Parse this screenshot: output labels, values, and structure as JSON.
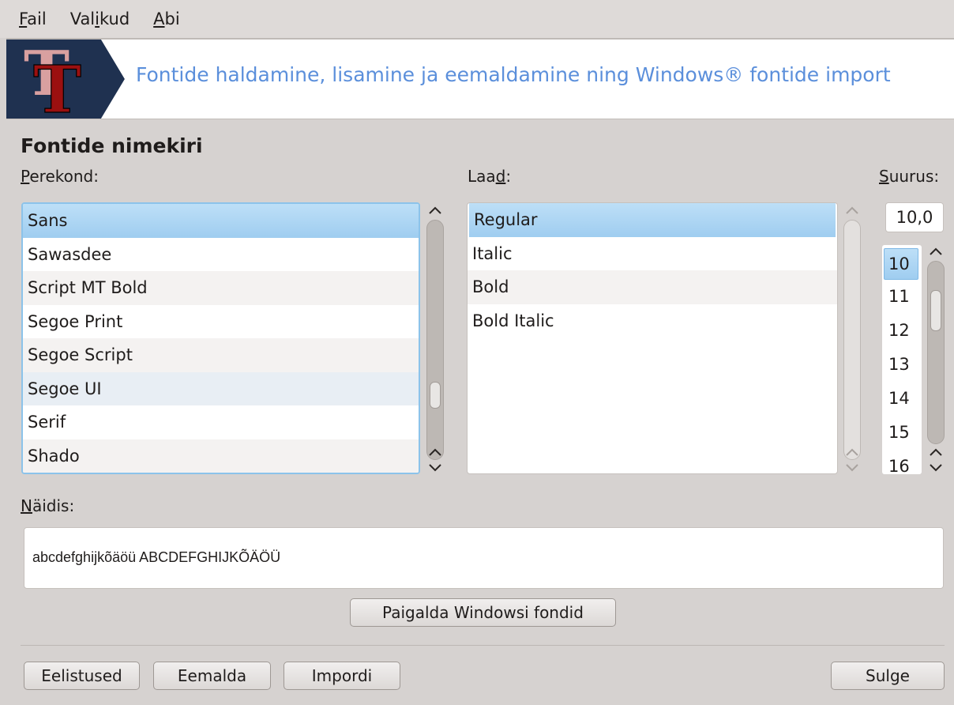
{
  "menu": {
    "items": [
      {
        "first": "F",
        "rest": "ail",
        "pre": ""
      },
      {
        "pre": "Val",
        "first": "i",
        "rest": "kud"
      },
      {
        "first": "A",
        "rest": "bi",
        "pre": ""
      }
    ]
  },
  "banner": {
    "text": "Fontide haldamine, lisamine ja eemaldamine ning Windows® fontide import",
    "logo_letters": "TT"
  },
  "section": {
    "title": "Fontide nimekiri"
  },
  "family": {
    "label_first": "P",
    "label_rest": "erekond:",
    "items": [
      "Sans",
      "Sawasdee",
      "Script MT Bold",
      "Segoe Print",
      "Segoe Script",
      "Segoe UI",
      "Serif",
      "Shado"
    ],
    "selected": "Sans"
  },
  "style": {
    "label_pre": "Laa",
    "label_u": "d",
    "label_post": ":",
    "items": [
      "Regular",
      "Italic",
      "Bold",
      "Bold Italic"
    ],
    "selected": "Regular"
  },
  "size": {
    "label_first": "S",
    "label_rest": "uurus:",
    "value": "10,0",
    "items": [
      "10",
      "11",
      "12",
      "13",
      "14",
      "15",
      "16"
    ],
    "selected": "10"
  },
  "preview": {
    "label_first": "N",
    "label_rest": "äidis:",
    "text": "abcdefghijkõäöü ABCDEFGHIJKÕÄÖÜ"
  },
  "buttons": {
    "install_windows": "Paigalda Windowsi fondid",
    "preferences": "Eelistused",
    "remove": "Eemalda",
    "import": "Impordi",
    "close": "Sulge"
  },
  "colors": {
    "banner_text": "#5b8fdb",
    "selection": "#a8d3f2",
    "focus_border": "#8cc3ea"
  }
}
